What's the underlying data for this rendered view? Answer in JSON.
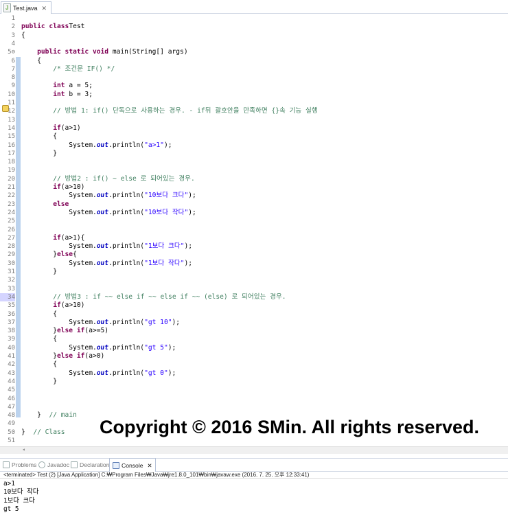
{
  "editor_tab": {
    "label": "Test.java",
    "close": "✕"
  },
  "code_lines": [
    {
      "n": "1",
      "parts": []
    },
    {
      "n": "2",
      "parts": [
        [
          "kw",
          "public class"
        ],
        [
          "",
          "Test"
        ]
      ]
    },
    {
      "n": "3",
      "parts": [
        [
          "",
          "{"
        ]
      ]
    },
    {
      "n": "4",
      "parts": []
    },
    {
      "n": "5⊖",
      "parts": [
        [
          "",
          "    "
        ],
        [
          "kw",
          "public static void"
        ],
        [
          "",
          " main(String[] args)"
        ]
      ]
    },
    {
      "n": "6",
      "parts": [
        [
          "",
          "    {"
        ]
      ]
    },
    {
      "n": "7",
      "parts": [
        [
          "",
          "        "
        ],
        [
          "cm",
          "/* 조건문 IF() */"
        ]
      ]
    },
    {
      "n": "8",
      "parts": []
    },
    {
      "n": "9",
      "parts": [
        [
          "",
          "        "
        ],
        [
          "kw",
          "int"
        ],
        [
          "",
          " a = 5;"
        ]
      ]
    },
    {
      "n": "10",
      "parts": [
        [
          "",
          "        "
        ],
        [
          "kw",
          "int"
        ],
        [
          "",
          " b = 3;"
        ]
      ]
    },
    {
      "n": "11",
      "parts": []
    },
    {
      "n": "12",
      "parts": [
        [
          "",
          "        "
        ],
        [
          "cm",
          "// 방법 1: if() 단독으로 사용하는 경우. - if뒤 괄호안을 만족하면 {}속 기능 실행"
        ]
      ]
    },
    {
      "n": "13",
      "parts": []
    },
    {
      "n": "14",
      "parts": [
        [
          "",
          "        "
        ],
        [
          "kw",
          "if"
        ],
        [
          "",
          "(a>1)"
        ]
      ]
    },
    {
      "n": "15",
      "parts": [
        [
          "",
          "        {"
        ]
      ]
    },
    {
      "n": "16",
      "parts": [
        [
          "",
          "            System."
        ],
        [
          "fd",
          "out"
        ],
        [
          "",
          ".println("
        ],
        [
          "st",
          "\"a>1\""
        ],
        [
          "",
          ");"
        ]
      ]
    },
    {
      "n": "17",
      "parts": [
        [
          "",
          "        }"
        ]
      ]
    },
    {
      "n": "18",
      "parts": []
    },
    {
      "n": "19",
      "parts": []
    },
    {
      "n": "20",
      "parts": [
        [
          "",
          "        "
        ],
        [
          "cm",
          "// 방법2 : if() ~ else 로 되어있는 경우."
        ]
      ]
    },
    {
      "n": "21",
      "parts": [
        [
          "",
          "        "
        ],
        [
          "kw",
          "if"
        ],
        [
          "",
          "(a>10)"
        ]
      ]
    },
    {
      "n": "22",
      "parts": [
        [
          "",
          "            System."
        ],
        [
          "fd",
          "out"
        ],
        [
          "",
          ".println("
        ],
        [
          "st",
          "\"10보다 크다\""
        ],
        [
          "",
          ");"
        ]
      ]
    },
    {
      "n": "23",
      "parts": [
        [
          "",
          "        "
        ],
        [
          "kw",
          "else"
        ]
      ]
    },
    {
      "n": "24",
      "parts": [
        [
          "",
          "            System."
        ],
        [
          "fd",
          "out"
        ],
        [
          "",
          ".println("
        ],
        [
          "st",
          "\"10보다 작다\""
        ],
        [
          "",
          ");"
        ]
      ]
    },
    {
      "n": "25",
      "parts": []
    },
    {
      "n": "26",
      "parts": []
    },
    {
      "n": "27",
      "parts": [
        [
          "",
          "        "
        ],
        [
          "kw",
          "if"
        ],
        [
          "",
          "(a>1){"
        ]
      ]
    },
    {
      "n": "28",
      "parts": [
        [
          "",
          "            System."
        ],
        [
          "fd",
          "out"
        ],
        [
          "",
          ".println("
        ],
        [
          "st",
          "\"1보다 크다\""
        ],
        [
          "",
          ");"
        ]
      ]
    },
    {
      "n": "29",
      "parts": [
        [
          "",
          "        }"
        ],
        [
          "kw",
          "else"
        ],
        [
          "",
          "{"
        ]
      ]
    },
    {
      "n": "30",
      "parts": [
        [
          "",
          "            System."
        ],
        [
          "fd",
          "out"
        ],
        [
          "",
          ".println("
        ],
        [
          "st",
          "\"1보다 작다\""
        ],
        [
          "",
          ");"
        ]
      ]
    },
    {
      "n": "31",
      "parts": [
        [
          "",
          "        }"
        ]
      ]
    },
    {
      "n": "32",
      "parts": []
    },
    {
      "n": "33",
      "parts": []
    },
    {
      "n": "34",
      "parts": [
        [
          "",
          "        "
        ],
        [
          "cm",
          "// 방법3 : if ~~ else if ~~ else if ~~ (else) 로 되어있는 경우."
        ]
      ]
    },
    {
      "n": "35",
      "parts": [
        [
          "",
          "        "
        ],
        [
          "kw",
          "if"
        ],
        [
          "",
          "(a>10)"
        ]
      ]
    },
    {
      "n": "36",
      "parts": [
        [
          "",
          "        {"
        ]
      ]
    },
    {
      "n": "37",
      "parts": [
        [
          "",
          "            System."
        ],
        [
          "fd",
          "out"
        ],
        [
          "",
          ".println("
        ],
        [
          "st",
          "\"gt 10\""
        ],
        [
          "",
          ");"
        ]
      ]
    },
    {
      "n": "38",
      "parts": [
        [
          "",
          "        }"
        ],
        [
          "kw",
          "else if"
        ],
        [
          "",
          "(a>=5)"
        ]
      ]
    },
    {
      "n": "39",
      "parts": [
        [
          "",
          "        {"
        ]
      ]
    },
    {
      "n": "40",
      "parts": [
        [
          "",
          "            System."
        ],
        [
          "fd",
          "out"
        ],
        [
          "",
          ".println("
        ],
        [
          "st",
          "\"gt 5\""
        ],
        [
          "",
          ");"
        ]
      ]
    },
    {
      "n": "41",
      "parts": [
        [
          "",
          "        }"
        ],
        [
          "kw",
          "else if"
        ],
        [
          "",
          "(a>0)"
        ]
      ]
    },
    {
      "n": "42",
      "parts": [
        [
          "",
          "        {"
        ]
      ]
    },
    {
      "n": "43",
      "parts": [
        [
          "",
          "            System."
        ],
        [
          "fd",
          "out"
        ],
        [
          "",
          ".println("
        ],
        [
          "st",
          "\"gt 0\""
        ],
        [
          "",
          ");"
        ]
      ]
    },
    {
      "n": "44",
      "parts": [
        [
          "",
          "        }"
        ]
      ]
    },
    {
      "n": "45",
      "parts": []
    },
    {
      "n": "46",
      "parts": []
    },
    {
      "n": "47",
      "parts": []
    },
    {
      "n": "48",
      "parts": [
        [
          "",
          "    }  "
        ],
        [
          "cm",
          "// main"
        ]
      ]
    },
    {
      "n": "49",
      "parts": []
    },
    {
      "n": "50",
      "parts": [
        [
          "",
          "}  "
        ],
        [
          "cm",
          "// Class"
        ]
      ]
    },
    {
      "n": "51",
      "parts": []
    }
  ],
  "copyright": "Copyright © 2016 SMin. All rights reserved.",
  "bottom_tabs": [
    {
      "label": "Problems",
      "active": false
    },
    {
      "label": "Javadoc",
      "active": false
    },
    {
      "label": "Declaration",
      "active": false
    },
    {
      "label": "Console",
      "active": true
    }
  ],
  "console_status": "<terminated> Test (2) [Java Application] C:₩Program Files₩Java₩jre1.8.0_101₩bin₩javaw.exe (2016. 7. 25. 오후 12:33:41)",
  "console_output": [
    "a>1",
    "10보다 작다",
    "1보다 크다",
    "gt 5"
  ]
}
